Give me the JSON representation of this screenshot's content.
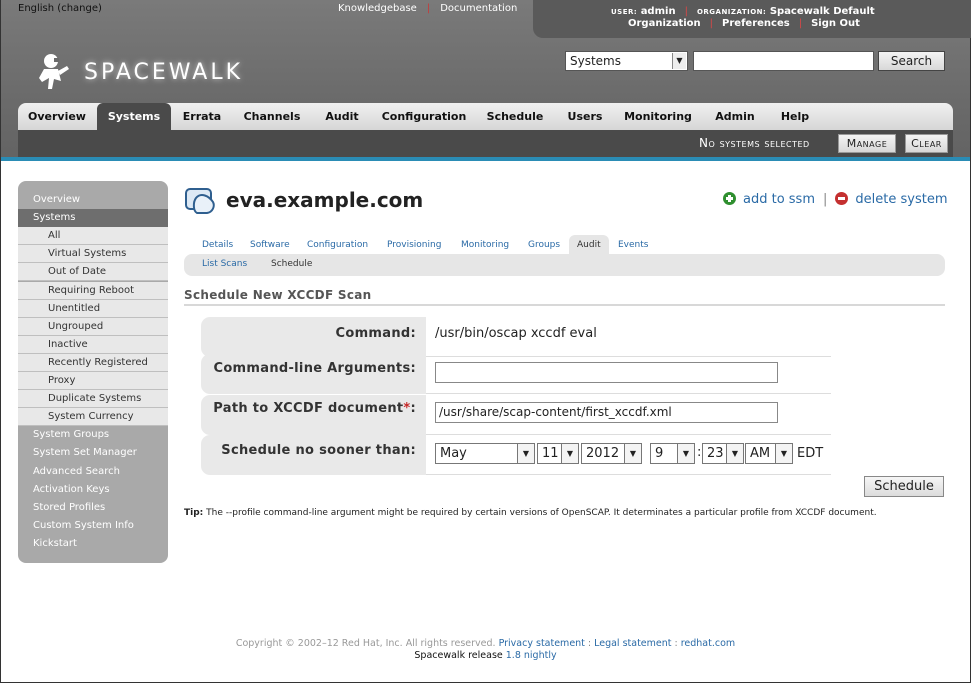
{
  "header": {
    "locale_lang": "English",
    "locale_change": "change",
    "top_links": [
      "Knowledgebase",
      "Documentation"
    ],
    "user_label": "USER:",
    "user_name": "admin",
    "org_label": "ORGANIZATION:",
    "org_name": "Spacewalk Default",
    "user_links": [
      "Organization",
      "Preferences",
      "Sign Out"
    ],
    "logo_text": "SPACEWALK",
    "search": {
      "scope": "Systems",
      "query": "",
      "button": "Search"
    },
    "nav_tabs": [
      "Overview",
      "Systems",
      "Errata",
      "Channels",
      "Audit",
      "Configuration",
      "Schedule",
      "Users",
      "Monitoring",
      "Admin",
      "Help"
    ],
    "active_tab": "Systems",
    "ssm": {
      "status": "No systems selected",
      "manage": "Manage",
      "clear": "Clear"
    }
  },
  "sidebar": {
    "items": [
      {
        "label": "Overview",
        "type": "top"
      },
      {
        "label": "Systems",
        "type": "top",
        "active": true
      },
      {
        "label": "All",
        "type": "sub"
      },
      {
        "label": "Virtual Systems",
        "type": "sub"
      },
      {
        "label": "Out of Date",
        "type": "sub"
      },
      {
        "label": "Requiring Reboot",
        "type": "sub"
      },
      {
        "label": "Unentitled",
        "type": "sub"
      },
      {
        "label": "Ungrouped",
        "type": "sub"
      },
      {
        "label": "Inactive",
        "type": "sub"
      },
      {
        "label": "Recently Registered",
        "type": "sub"
      },
      {
        "label": "Proxy",
        "type": "sub"
      },
      {
        "label": "Duplicate Systems",
        "type": "sub"
      },
      {
        "label": "System Currency",
        "type": "sub"
      },
      {
        "label": "System Groups",
        "type": "top"
      },
      {
        "label": "System Set Manager",
        "type": "top"
      },
      {
        "label": "Advanced Search",
        "type": "top"
      },
      {
        "label": "Activation Keys",
        "type": "top"
      },
      {
        "label": "Stored Profiles",
        "type": "top"
      },
      {
        "label": "Custom System Info",
        "type": "top"
      },
      {
        "label": "Kickstart",
        "type": "top"
      }
    ]
  },
  "system": {
    "hostname": "eva.example.com",
    "add_to_ssm": "add to ssm",
    "delete_system": "delete system"
  },
  "subtabs": [
    "Details",
    "Software",
    "Configuration",
    "Provisioning",
    "Monitoring",
    "Groups",
    "Audit",
    "Events"
  ],
  "active_subtab": "Audit",
  "subsubtabs": [
    "List Scans",
    "Schedule"
  ],
  "active_subsubtab": "Schedule",
  "form": {
    "heading": "Schedule New XCCDF Scan",
    "command_label": "Command:",
    "command_value": "/usr/bin/oscap xccdf eval",
    "args_label": "Command-line Arguments:",
    "args_value": "",
    "path_label": "Path to XCCDF document",
    "path_required": "*",
    "path_colon": ":",
    "path_value": "/usr/share/scap-content/first_xccdf.xml",
    "schedule_label": "Schedule no sooner than:",
    "month": "May",
    "day": "11",
    "year": "2012",
    "hour": "9",
    "time_sep": ":",
    "minute": "23",
    "ampm": "AM",
    "timezone": "EDT",
    "submit": "Schedule"
  },
  "tip": {
    "label": "Tip:",
    "text": "The --profile command-line argument might be required by certain versions of OpenSCAP. It determinates a particular profile from XCCDF document."
  },
  "footer": {
    "copyright": "Copyright © 2002–12 Red Hat, Inc. All rights reserved.",
    "links": [
      "Privacy statement",
      "Legal statement",
      "redhat.com"
    ],
    "release_label": "Spacewalk release",
    "release_version": "1.8 nightly"
  },
  "colors": {
    "header_bg": "#6b6b6b",
    "accent_bar": "#2a8cb5",
    "link": "#2a6aa6",
    "required": "#c62828"
  }
}
